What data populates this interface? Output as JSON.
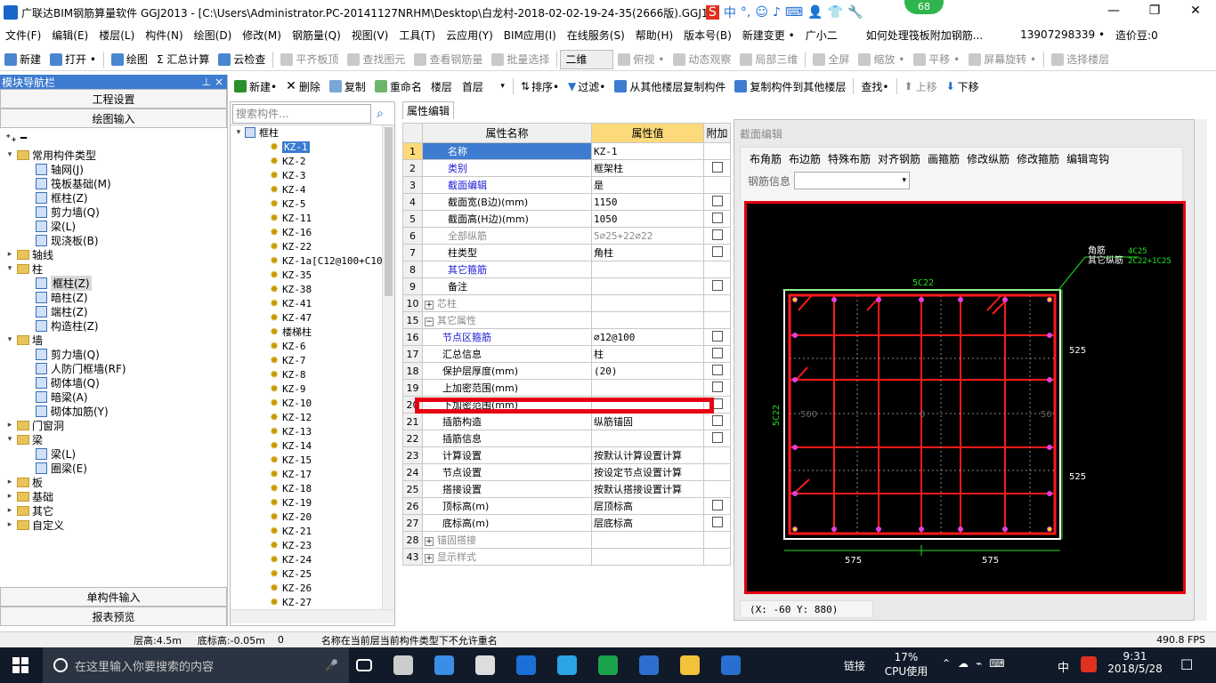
{
  "window": {
    "title": "广联达BIM钢筋算量软件 GGJ2013 - [C:\\Users\\Administrator.PC-20141127NRHM\\Desktop\\白龙村-2018-02-02-19-24-35(2666版).GGJ12]",
    "badge": "68",
    "ime": [
      "S",
      "中",
      "°,",
      "☺",
      "♪",
      "⌨",
      "👤",
      "👕",
      "🔧"
    ],
    "min": "—",
    "max": "❐",
    "close": "✕"
  },
  "menu": [
    "文件(F)",
    "编辑(E)",
    "楼层(L)",
    "构件(N)",
    "绘图(D)",
    "修改(M)",
    "钢筋量(Q)",
    "视图(V)",
    "工具(T)",
    "云应用(Y)",
    "BIM应用(I)",
    "在线服务(S)",
    "帮助(H)",
    "版本号(B)",
    "新建变更 •",
    "广小二",
    "如何处理筏板附加钢筋...",
    "13907298339 •",
    "造价豆:0"
  ],
  "toolbar1": [
    "新建",
    "打开 •",
    "绘图",
    "Σ 汇总计算",
    "云检查",
    "平齐板顶",
    "查找图元",
    "查看钢筋量",
    "批量选择",
    "二维",
    "俯视 •",
    "动态观察",
    "局部三维",
    "全屏",
    "缩放 •",
    "平移 •",
    "屏幕旋转 •",
    "选择楼层"
  ],
  "toolbar2": {
    "new": "新建•",
    "del": "删除",
    "copy": "复制",
    "rename": "重命名",
    "floor_label": "楼层",
    "floor": "首层",
    "sort": "排序•",
    "filter": "过滤•",
    "copy_from": "从其他楼层复制构件",
    "copy_to": "复制构件到其他楼层",
    "find": "查找•",
    "up": "上移",
    "down": "下移"
  },
  "nav": {
    "title": "模块导航栏",
    "pin": "⊥ ×",
    "proj": "工程设置",
    "draw": "绘图输入",
    "single": "单构件输入",
    "report": "报表预览",
    "tree": [
      {
        "l": 0,
        "t": "常用构件类型",
        "o": "▾",
        "f": 1
      },
      {
        "l": 1,
        "t": "轴网(J)",
        "i": 1
      },
      {
        "l": 1,
        "t": "筏板基础(M)",
        "i": 1
      },
      {
        "l": 1,
        "t": "框柱(Z)",
        "i": 1
      },
      {
        "l": 1,
        "t": "剪力墙(Q)",
        "i": 1
      },
      {
        "l": 1,
        "t": "梁(L)",
        "i": 1
      },
      {
        "l": 1,
        "t": "现浇板(B)",
        "i": 1
      },
      {
        "l": 0,
        "t": "轴线",
        "o": "▸",
        "f": 1
      },
      {
        "l": 0,
        "t": "柱",
        "o": "▾",
        "f": 1
      },
      {
        "l": 1,
        "t": "框柱(Z)",
        "i": 1,
        "s": 1
      },
      {
        "l": 1,
        "t": "暗柱(Z)",
        "i": 1
      },
      {
        "l": 1,
        "t": "端柱(Z)",
        "i": 1
      },
      {
        "l": 1,
        "t": "构造柱(Z)",
        "i": 1
      },
      {
        "l": 0,
        "t": "墙",
        "o": "▾",
        "f": 1
      },
      {
        "l": 1,
        "t": "剪力墙(Q)",
        "i": 1
      },
      {
        "l": 1,
        "t": "人防门框墙(RF)",
        "i": 1
      },
      {
        "l": 1,
        "t": "砌体墙(Q)",
        "i": 1
      },
      {
        "l": 1,
        "t": "暗梁(A)",
        "i": 1
      },
      {
        "l": 1,
        "t": "砌体加筋(Y)",
        "i": 1
      },
      {
        "l": 0,
        "t": "门窗洞",
        "o": "▸",
        "f": 1
      },
      {
        "l": 0,
        "t": "梁",
        "o": "▾",
        "f": 1
      },
      {
        "l": 1,
        "t": "梁(L)",
        "i": 1
      },
      {
        "l": 1,
        "t": "圈梁(E)",
        "i": 1
      },
      {
        "l": 0,
        "t": "板",
        "o": "▸",
        "f": 1
      },
      {
        "l": 0,
        "t": "基础",
        "o": "▸",
        "f": 1
      },
      {
        "l": 0,
        "t": "其它",
        "o": "▸",
        "f": 1
      },
      {
        "l": 0,
        "t": "自定义",
        "o": "▸",
        "f": 1
      }
    ]
  },
  "list": {
    "placeholder": "搜索构件...",
    "root": "框柱",
    "items": [
      "KZ-1",
      "KZ-2",
      "KZ-3",
      "KZ-4",
      "KZ-5",
      "KZ-11",
      "KZ-16",
      "KZ-22",
      "KZ-1a[C12@100+C10",
      "KZ-35",
      "KZ-38",
      "KZ-41",
      "KZ-47",
      "楼梯柱",
      "KZ-6",
      "KZ-7",
      "KZ-8",
      "KZ-9",
      "KZ-10",
      "KZ-12",
      "KZ-13",
      "KZ-14",
      "KZ-15",
      "KZ-17",
      "KZ-18",
      "KZ-19",
      "KZ-20",
      "KZ-21",
      "KZ-23",
      "KZ-24",
      "KZ-25",
      "KZ-26",
      "KZ-27"
    ]
  },
  "props": {
    "tab": "属性编辑",
    "h_name": "属性名称",
    "h_val": "属性值",
    "h_add": "附加",
    "rows": [
      {
        "n": "1",
        "k": "名称",
        "v": "KZ-1",
        "c": "blue",
        "cb": 0,
        "sel": 1
      },
      {
        "n": "2",
        "k": "类别",
        "v": "框架柱",
        "c": "blue",
        "cb": 1
      },
      {
        "n": "3",
        "k": "截面编辑",
        "v": "是",
        "c": "blue",
        "cb": 0
      },
      {
        "n": "4",
        "k": "截面宽(B边)(mm)",
        "v": "1150",
        "c": "",
        "cb": 1
      },
      {
        "n": "5",
        "k": "截面高(H边)(mm)",
        "v": "1050",
        "c": "",
        "cb": 1
      },
      {
        "n": "6",
        "k": "全部纵筋",
        "v": "5⌀25+22⌀22",
        "c": "grey",
        "cb": 1
      },
      {
        "n": "7",
        "k": "柱类型",
        "v": "角柱",
        "c": "",
        "cb": 1
      },
      {
        "n": "8",
        "k": "其它箍筋",
        "v": "",
        "c": "blue",
        "cb": 0
      },
      {
        "n": "9",
        "k": "备注",
        "v": "",
        "c": "",
        "cb": 1
      },
      {
        "n": "10",
        "k": "芯柱",
        "v": "",
        "c": "grey",
        "cb": 0,
        "ex": "+"
      },
      {
        "n": "15",
        "k": "其它属性",
        "v": "",
        "c": "grey",
        "cb": 0,
        "ex": "−"
      },
      {
        "n": "16",
        "k": "节点区箍筋",
        "v": "⌀12@100",
        "c": "blue",
        "cb": 1,
        "ind": 1
      },
      {
        "n": "17",
        "k": "汇总信息",
        "v": "柱",
        "c": "",
        "cb": 1,
        "ind": 1
      },
      {
        "n": "18",
        "k": "保护层厚度(mm)",
        "v": "(20)",
        "c": "",
        "cb": 1,
        "ind": 1
      },
      {
        "n": "19",
        "k": "上加密范围(mm)",
        "v": "",
        "c": "",
        "cb": 1,
        "ind": 1
      },
      {
        "n": "20",
        "k": "下加密范围(mm)",
        "v": "",
        "c": "",
        "cb": 1,
        "ind": 1
      },
      {
        "n": "21",
        "k": "插筋构造",
        "v": "纵筋锚固",
        "c": "",
        "cb": 1,
        "ind": 1
      },
      {
        "n": "22",
        "k": "插筋信息",
        "v": "",
        "c": "",
        "cb": 1,
        "ind": 1
      },
      {
        "n": "23",
        "k": "计算设置",
        "v": "按默认计算设置计算",
        "c": "",
        "cb": 0,
        "ind": 1
      },
      {
        "n": "24",
        "k": "节点设置",
        "v": "按设定节点设置计算",
        "c": "",
        "cb": 0,
        "ind": 1
      },
      {
        "n": "25",
        "k": "搭接设置",
        "v": "按默认搭接设置计算",
        "c": "",
        "cb": 0,
        "ind": 1
      },
      {
        "n": "26",
        "k": "顶标高(m)",
        "v": "层顶标高",
        "c": "",
        "cb": 1,
        "ind": 1
      },
      {
        "n": "27",
        "k": "底标高(m)",
        "v": "层底标高",
        "c": "",
        "cb": 1,
        "ind": 1
      },
      {
        "n": "28",
        "k": "锚固搭接",
        "v": "",
        "c": "grey",
        "cb": 0,
        "ex": "+"
      },
      {
        "n": "43",
        "k": "显示样式",
        "v": "",
        "c": "grey",
        "cb": 0,
        "ex": "+"
      }
    ]
  },
  "section": {
    "title": "截面编辑",
    "tools": [
      "布角筋",
      "布边筋",
      "特殊布筋",
      "对齐钢筋",
      "画箍筋",
      "修改纵筋",
      "修改箍筋",
      "编辑弯钩"
    ],
    "rebar_label": "钢筋信息",
    "coord": "(X: -60 Y: 880)",
    "labels": {
      "top": "5C22",
      "left": "5C22",
      "corner": "角筋",
      "other": "其它纵筋",
      "corner_v": "4C25",
      "other_v": "2C22+1C25",
      "d525a": "525",
      "d525b": "525",
      "d575a": "575",
      "d575b": "575",
      "mid_l": "500",
      "mid_c": "0",
      "mid_r": "50"
    }
  },
  "status": {
    "floor_h": "层高:4.5m",
    "base": "底标高:-0.05m",
    "zero": "0",
    "msg": "名称在当前层当前构件类型下不允许重名",
    "fps": "490.8 FPS"
  },
  "taskbar": {
    "search": "在这里输入你要搜索的内容",
    "link": "链接",
    "cpu": "17%",
    "cpu_l": "CPU使用",
    "time": "9:31",
    "date": "2018/5/28",
    "lang": "中"
  },
  "colors": {
    "accent": "#3d7cd0",
    "rebar": "#ff1a1a",
    "highlight": "#e60012"
  }
}
